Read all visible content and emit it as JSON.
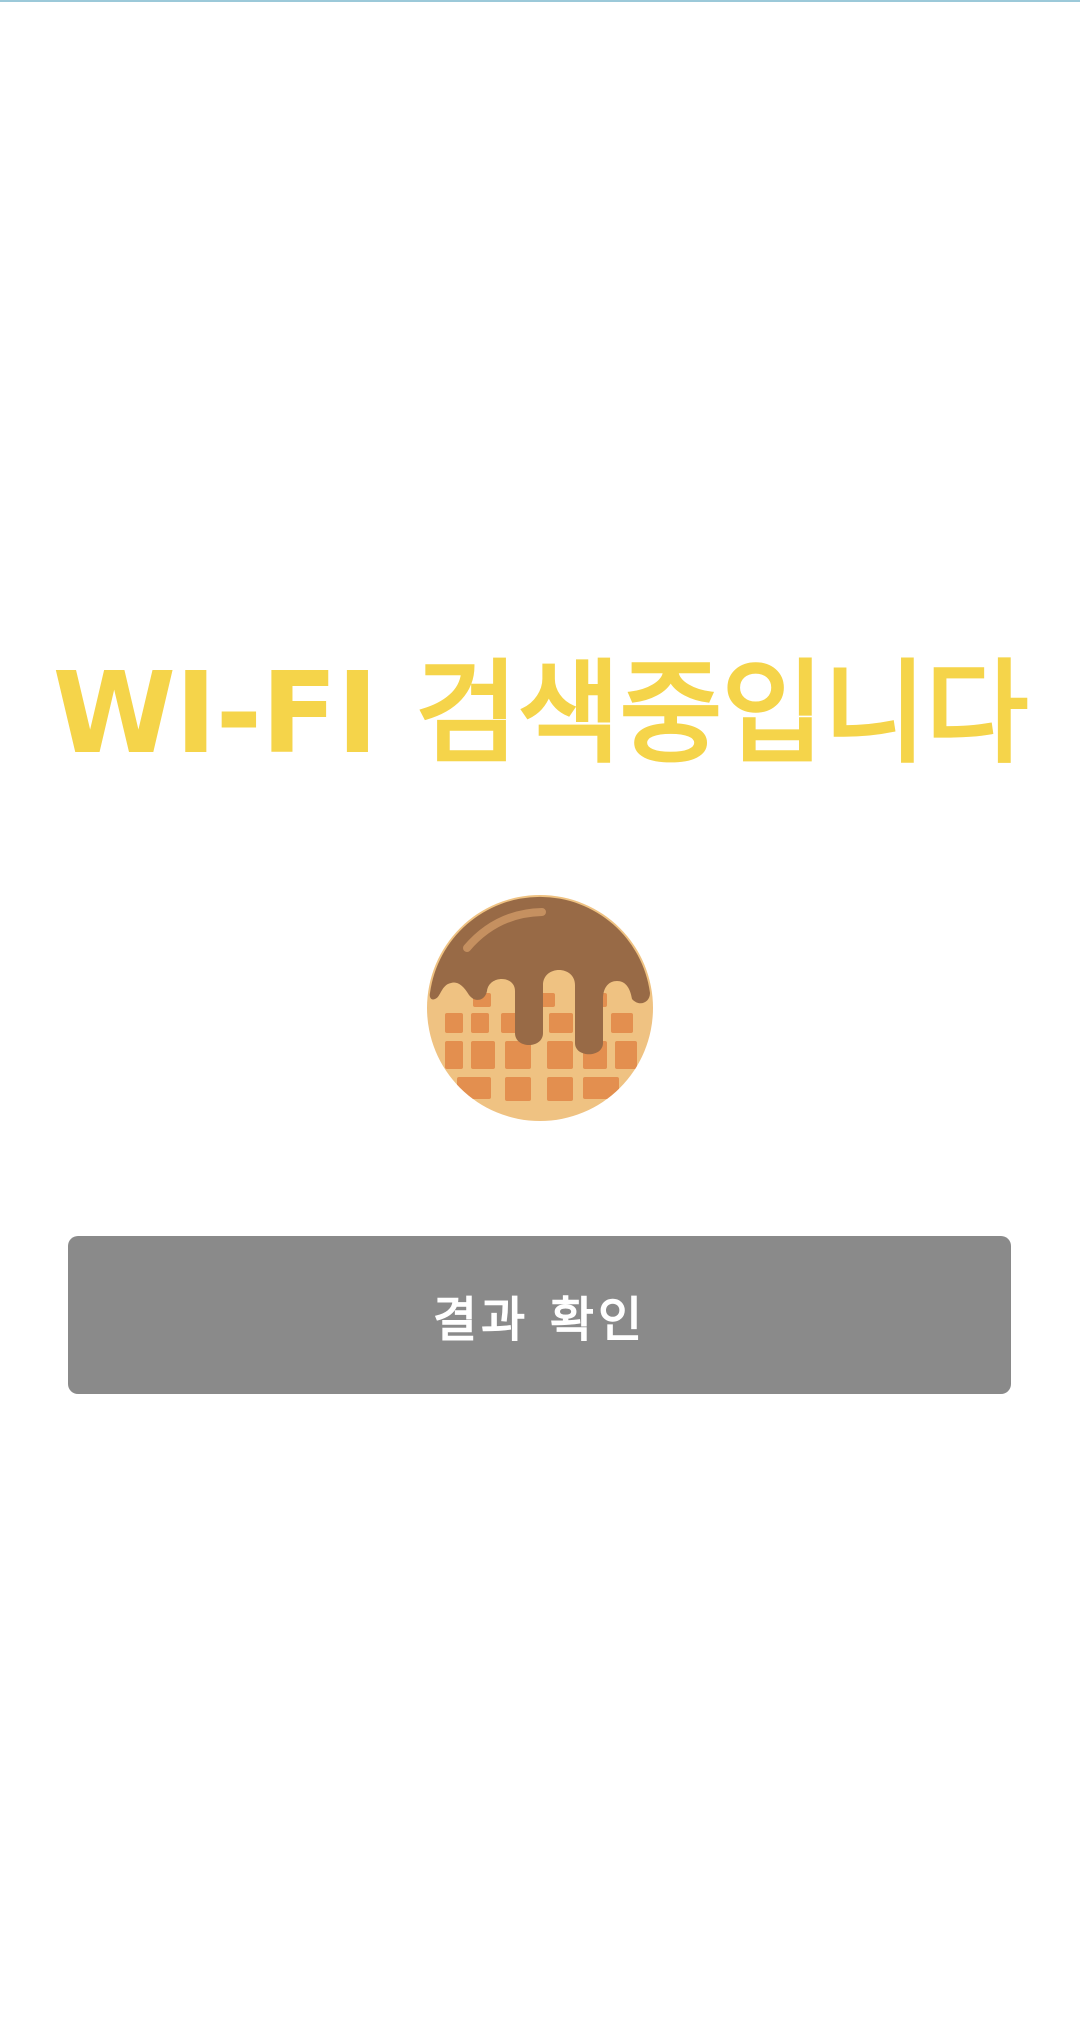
{
  "screen": {
    "title": "WI-FI 검색중입니다",
    "loading_icon": "waffle-icon",
    "result_button_label": "결과 확인"
  },
  "colors": {
    "title": "#f5d44a",
    "button_background": "#8a8a8a",
    "button_text": "#ffffff",
    "waffle_base": "#efc282",
    "waffle_cells": "#e38f4f",
    "chocolate": "#986a46",
    "chocolate_highlight": "#c59060",
    "status_line": "#9cc9d9"
  }
}
